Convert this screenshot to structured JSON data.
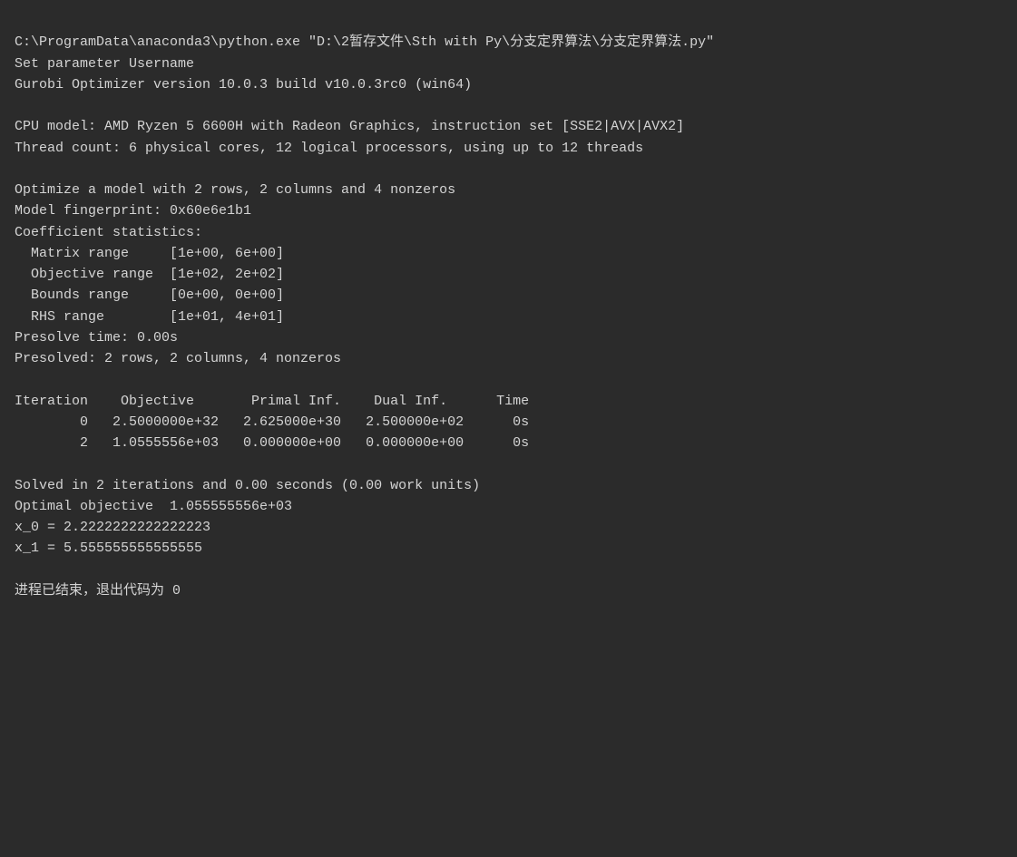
{
  "terminal": {
    "lines": [
      {
        "id": "cmd-line",
        "text": "C:\\ProgramData\\anaconda3\\python.exe \"D:\\2暂存文件\\Sth with Py\\分支定界算法\\分支定界算法.py\"",
        "type": "normal"
      },
      {
        "id": "set-param",
        "text": "Set parameter Username",
        "type": "normal"
      },
      {
        "id": "gurobi-ver",
        "text": "Gurobi Optimizer version 10.0.3 build v10.0.3rc0 (win64)",
        "type": "normal"
      },
      {
        "id": "empty1",
        "text": "",
        "type": "empty"
      },
      {
        "id": "cpu-model",
        "text": "CPU model: AMD Ryzen 5 6600H with Radeon Graphics, instruction set [SSE2|AVX|AVX2]",
        "type": "normal"
      },
      {
        "id": "thread-count",
        "text": "Thread count: 6 physical cores, 12 logical processors, using up to 12 threads",
        "type": "normal"
      },
      {
        "id": "empty2",
        "text": "",
        "type": "empty"
      },
      {
        "id": "optimize",
        "text": "Optimize a model with 2 rows, 2 columns and 4 nonzeros",
        "type": "normal"
      },
      {
        "id": "fingerprint",
        "text": "Model fingerprint: 0x60e6e1b1",
        "type": "normal"
      },
      {
        "id": "coeff-stats",
        "text": "Coefficient statistics:",
        "type": "normal"
      },
      {
        "id": "matrix-range",
        "text": "  Matrix range     [1e+00, 6e+00]",
        "type": "normal"
      },
      {
        "id": "obj-range",
        "text": "  Objective range  [1e+02, 2e+02]",
        "type": "normal"
      },
      {
        "id": "bounds-range",
        "text": "  Bounds range     [0e+00, 0e+00]",
        "type": "normal"
      },
      {
        "id": "rhs-range",
        "text": "  RHS range        [1e+01, 4e+01]",
        "type": "normal"
      },
      {
        "id": "presolve-time",
        "text": "Presolve time: 0.00s",
        "type": "normal"
      },
      {
        "id": "presolved",
        "text": "Presolved: 2 rows, 2 columns, 4 nonzeros",
        "type": "normal"
      },
      {
        "id": "empty3",
        "text": "",
        "type": "empty"
      },
      {
        "id": "table-header",
        "text": "Iteration    Objective       Primal Inf.    Dual Inf.      Time",
        "type": "normal"
      },
      {
        "id": "row0",
        "text": "        0   2.5000000e+32   2.625000e+30   2.500000e+02      0s",
        "type": "normal"
      },
      {
        "id": "row2",
        "text": "        2   1.0555556e+03   0.000000e+00   0.000000e+00      0s",
        "type": "normal"
      },
      {
        "id": "empty4",
        "text": "",
        "type": "empty"
      },
      {
        "id": "solved",
        "text": "Solved in 2 iterations and 0.00 seconds (0.00 work units)",
        "type": "normal"
      },
      {
        "id": "optimal-obj",
        "text": "Optimal objective  1.055555556e+03",
        "type": "normal"
      },
      {
        "id": "x0",
        "text": "x_0 = 2.2222222222222223",
        "type": "normal"
      },
      {
        "id": "x1",
        "text": "x_1 = 5.555555555555555",
        "type": "normal"
      },
      {
        "id": "empty5",
        "text": "",
        "type": "empty"
      },
      {
        "id": "exit",
        "text": "进程已结束，退出代码为 0",
        "type": "chinese"
      }
    ]
  }
}
